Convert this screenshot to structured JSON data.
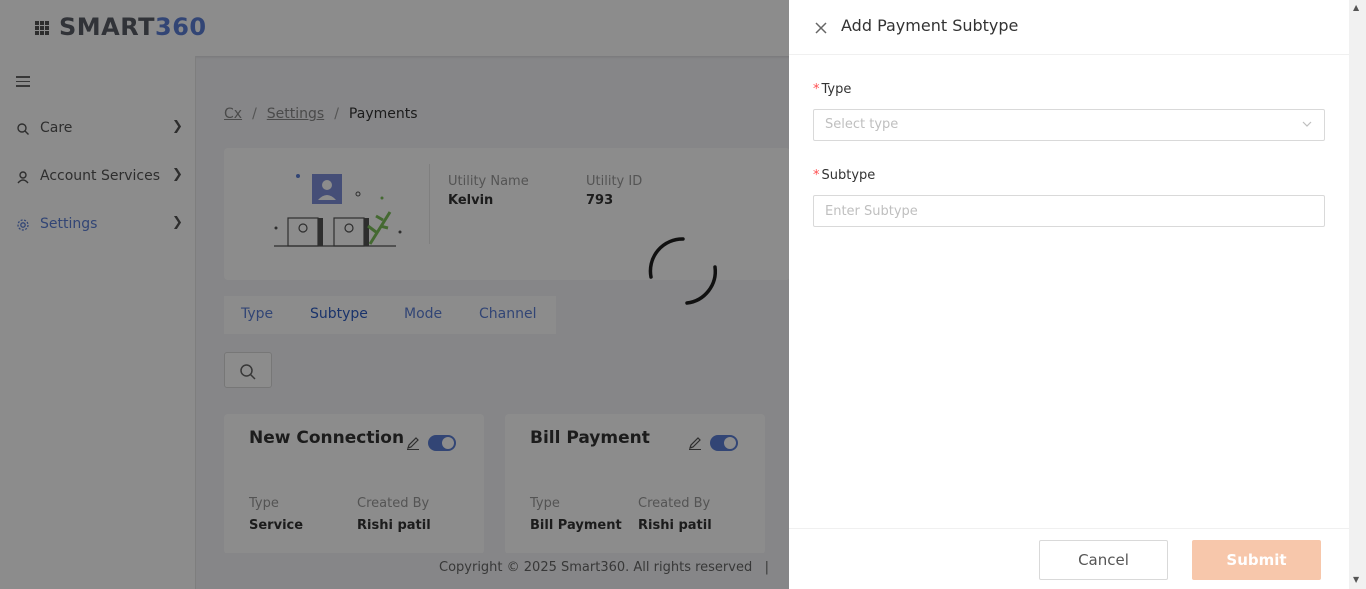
{
  "app": {
    "logo_part1": "SMART",
    "logo_part2": "360"
  },
  "sidebar": {
    "items": [
      {
        "label": "Care"
      },
      {
        "label": "Account Services"
      },
      {
        "label": "Settings"
      }
    ]
  },
  "breadcrumb": {
    "items": [
      "Cx",
      "Settings",
      "Payments"
    ],
    "separator": "/"
  },
  "utility": {
    "name_label": "Utility Name",
    "name_value": "Kelvin",
    "id_label": "Utility ID",
    "id_value": "793"
  },
  "tabs": [
    {
      "label": "Type"
    },
    {
      "label": "Subtype"
    },
    {
      "label": "Mode"
    },
    {
      "label": "Channel"
    }
  ],
  "cards": [
    {
      "title": "New Connection",
      "type_label": "Type",
      "type_value": "Service",
      "created_label": "Created By",
      "created_value": "Rishi patil"
    },
    {
      "title": "Bill Payment",
      "type_label": "Type",
      "type_value": "Bill Payment",
      "created_label": "Created By",
      "created_value": "Rishi patil"
    }
  ],
  "footer": {
    "text": "Copyright © 2025 Smart360. All rights reserved   |"
  },
  "drawer": {
    "title": "Add Payment Subtype",
    "type_field": {
      "required_mark": "*",
      "label": "Type",
      "placeholder": "Select type"
    },
    "subtype_field": {
      "required_mark": "*",
      "label": "Subtype",
      "placeholder": "Enter Subtype"
    },
    "cancel_label": "Cancel",
    "submit_label": "Submit"
  },
  "colors": {
    "brand_blue": "#5b7fd6",
    "submit_disabled": "#f7c7ab",
    "required": "#ff4d4f"
  }
}
